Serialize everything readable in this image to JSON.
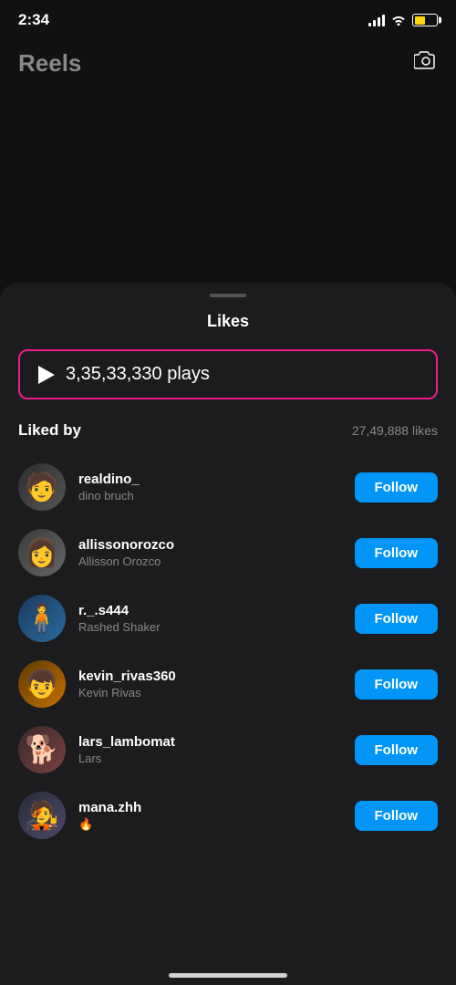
{
  "statusBar": {
    "time": "2:34",
    "battery": "50"
  },
  "topBar": {
    "title": "Reels"
  },
  "sheet": {
    "title": "Likes",
    "plays": "3,35,33,330 plays",
    "likedByLabel": "Liked by",
    "likesCount": "27,49,888 likes"
  },
  "users": [
    {
      "username": "realdino_",
      "fullName": "dino bruch",
      "followLabel": "Follow",
      "avatarClass": "av-1"
    },
    {
      "username": "allissonorozco",
      "fullName": "Allisson Orozco",
      "followLabel": "Follow",
      "avatarClass": "av-2"
    },
    {
      "username": "r._.s444",
      "fullName": "Rashed Shaker",
      "followLabel": "Follow",
      "avatarClass": "av-3"
    },
    {
      "username": "kevin_rivas360",
      "fullName": "Kevin Rivas",
      "followLabel": "Follow",
      "avatarClass": "av-4"
    },
    {
      "username": "lars_lambomat",
      "fullName": "Lars",
      "followLabel": "Follow",
      "avatarClass": "av-5"
    },
    {
      "username": "mana.zhh",
      "fullName": "🔥",
      "followLabel": "Follow",
      "avatarClass": "av-6"
    }
  ]
}
